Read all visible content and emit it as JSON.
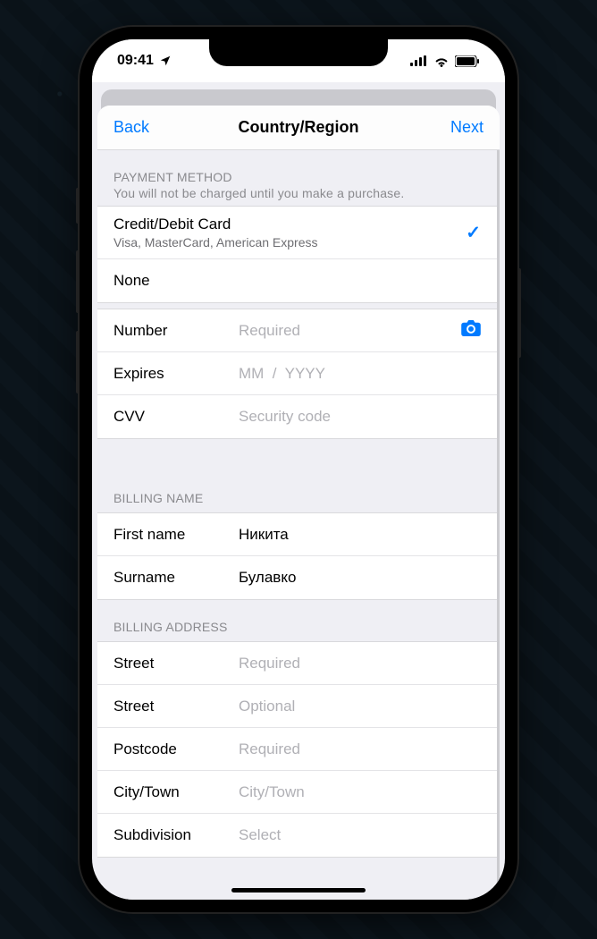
{
  "status": {
    "time": "09:41"
  },
  "nav": {
    "back": "Back",
    "title": "Country/Region",
    "next": "Next"
  },
  "payment_method": {
    "header": "PAYMENT METHOD",
    "subheader": "You will not be charged until you make a purchase.",
    "options": {
      "credit": {
        "title": "Credit/Debit Card",
        "sub": "Visa, MasterCard, American Express",
        "selected": true
      },
      "none": {
        "title": "None"
      }
    },
    "fields": {
      "number": {
        "label": "Number",
        "placeholder": "Required",
        "value": ""
      },
      "expires": {
        "label": "Expires",
        "placeholder": "MM  /  YYYY",
        "value": ""
      },
      "cvv": {
        "label": "CVV",
        "placeholder": "Security code",
        "value": ""
      }
    }
  },
  "billing_name": {
    "header": "BILLING NAME",
    "first": {
      "label": "First name",
      "value": "Никита"
    },
    "surname": {
      "label": "Surname",
      "value": "Булавко"
    }
  },
  "billing_address": {
    "header": "BILLING ADDRESS",
    "street1": {
      "label": "Street",
      "placeholder": "Required",
      "value": ""
    },
    "street2": {
      "label": "Street",
      "placeholder": "Optional",
      "value": ""
    },
    "postcode": {
      "label": "Postcode",
      "placeholder": "Required",
      "value": ""
    },
    "city": {
      "label": "City/Town",
      "placeholder": "City/Town",
      "value": ""
    },
    "subdivision": {
      "label": "Subdivision",
      "placeholder": "Select",
      "value": ""
    }
  }
}
